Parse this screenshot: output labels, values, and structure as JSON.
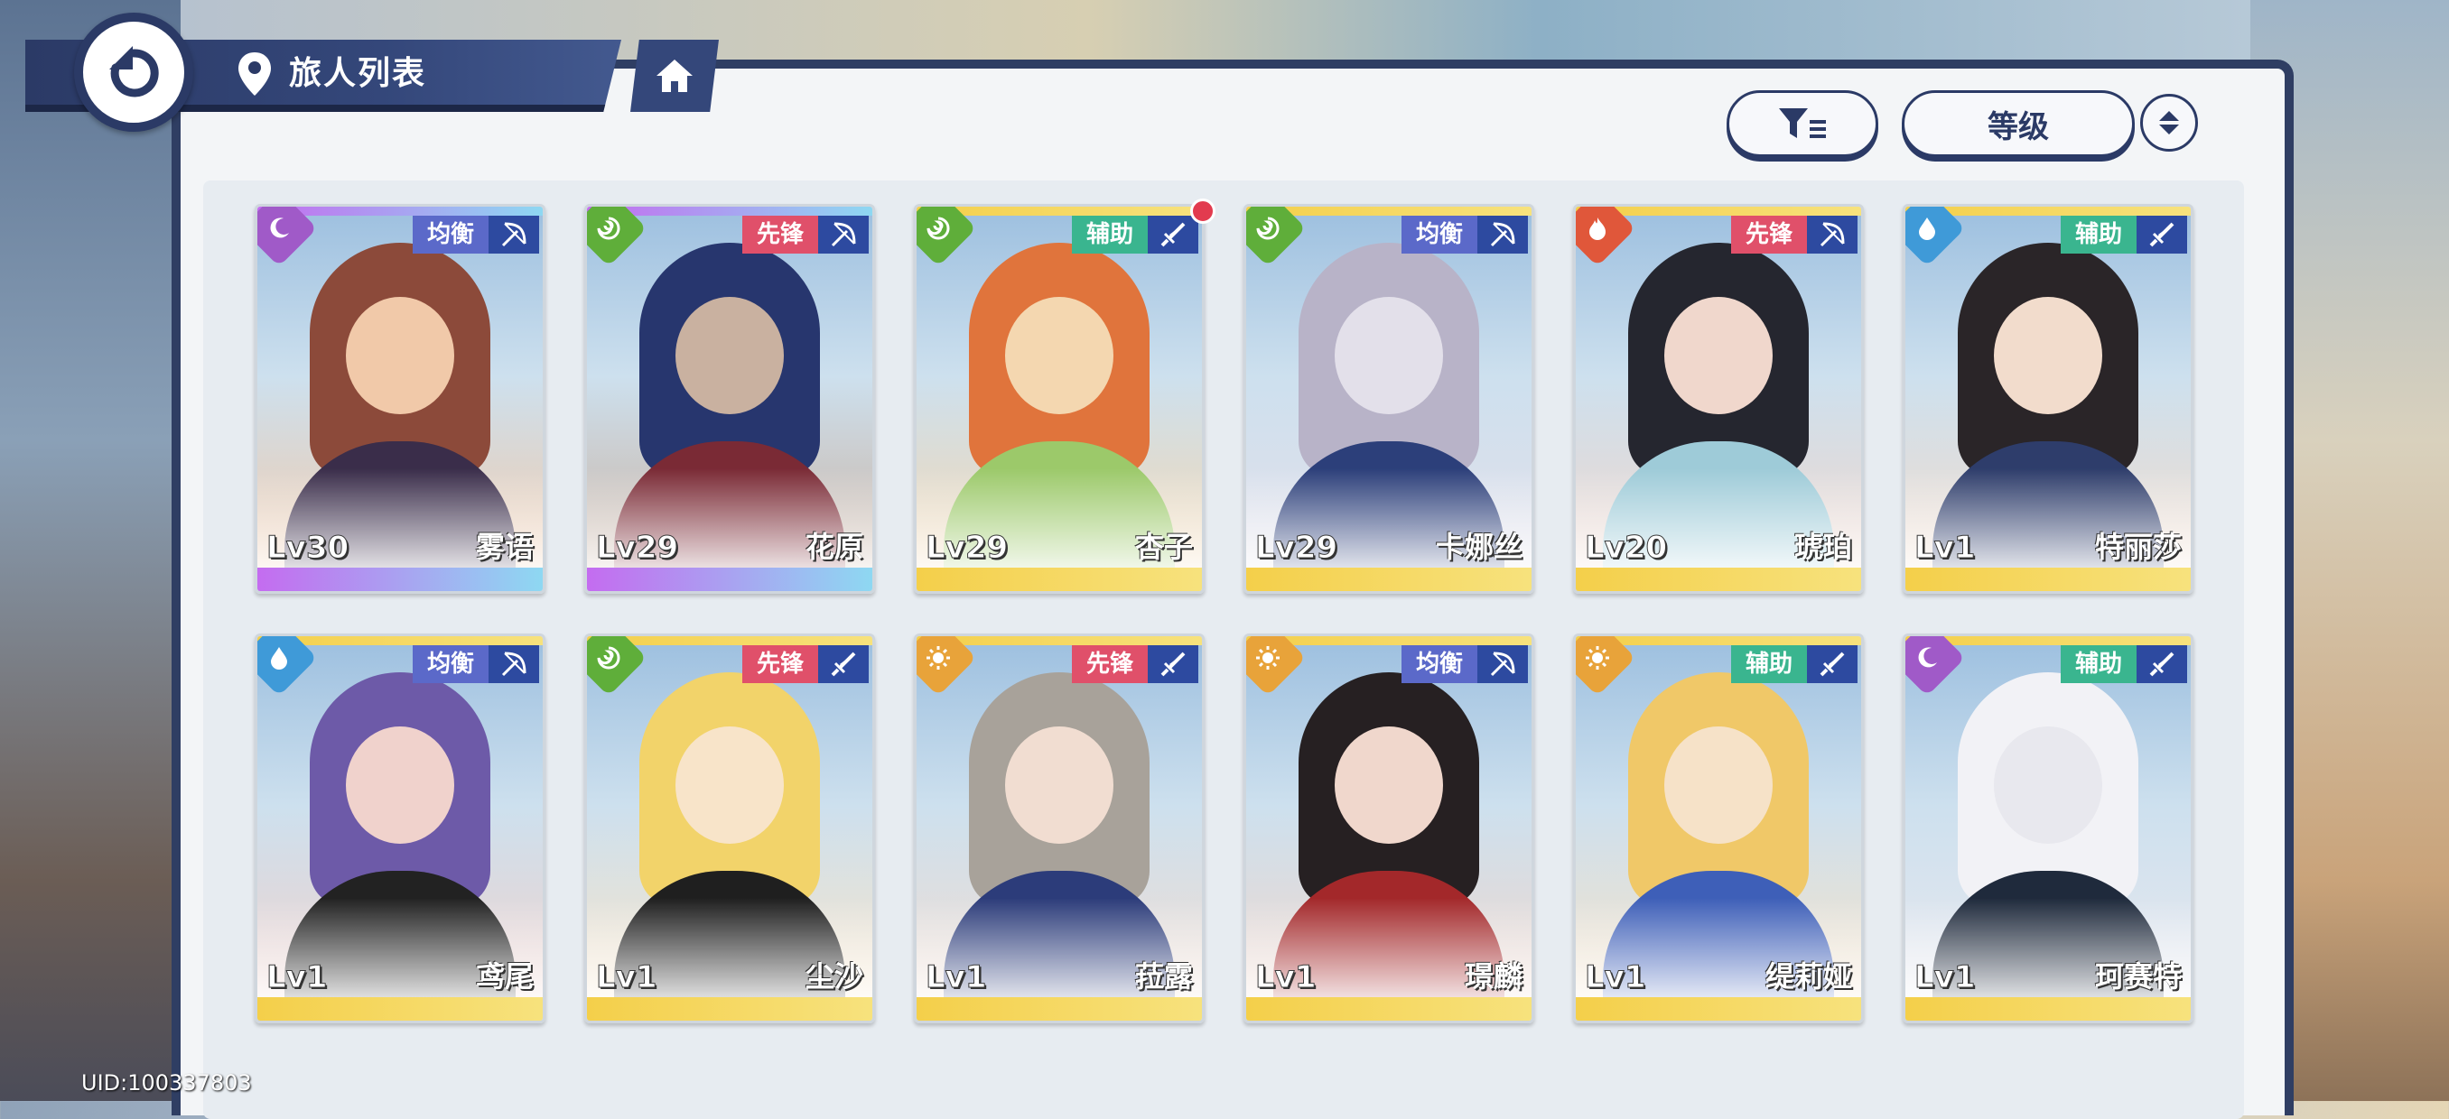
{
  "header": {
    "title": "旅人列表"
  },
  "toolbar": {
    "sort_label": "等级"
  },
  "footer": {
    "uid": "UID:100337803"
  },
  "colors": {
    "navy": "#2b3a66",
    "balance": "#5b69c9",
    "vanguard": "#e0506a",
    "support": "#3ab58f"
  },
  "characters": [
    {
      "name": "雾语",
      "level": "Lv30",
      "role": "均衡",
      "element": "moon",
      "weapon": "bow-icon",
      "rarity": "purple"
    },
    {
      "name": "花原",
      "level": "Lv29",
      "role": "先锋",
      "element": "wind",
      "weapon": "bow-icon",
      "rarity": "purple"
    },
    {
      "name": "杏子",
      "level": "Lv29",
      "role": "辅助",
      "element": "wind",
      "weapon": "sword-icon",
      "rarity": "gold"
    },
    {
      "name": "卡娜丝",
      "level": "Lv29",
      "role": "均衡",
      "element": "wind",
      "weapon": "bow-icon",
      "rarity": "gold"
    },
    {
      "name": "琥珀",
      "level": "Lv20",
      "role": "先锋",
      "element": "fire",
      "weapon": "bow-icon",
      "rarity": "gold"
    },
    {
      "name": "特丽莎",
      "level": "Lv1",
      "role": "辅助",
      "element": "water",
      "weapon": "sword-icon",
      "rarity": "gold"
    },
    {
      "name": "鸢尾",
      "level": "Lv1",
      "role": "均衡",
      "element": "water",
      "weapon": "bow-icon",
      "rarity": "gold"
    },
    {
      "name": "尘沙",
      "level": "Lv1",
      "role": "先锋",
      "element": "wind",
      "weapon": "sword-icon",
      "rarity": "gold"
    },
    {
      "name": "菈露",
      "level": "Lv1",
      "role": "先锋",
      "element": "sun",
      "weapon": "sword-icon",
      "rarity": "gold"
    },
    {
      "name": "璟麟",
      "level": "Lv1",
      "role": "均衡",
      "element": "sun",
      "weapon": "bow-icon",
      "rarity": "gold"
    },
    {
      "name": "缇莉娅",
      "level": "Lv1",
      "role": "辅助",
      "element": "sun",
      "weapon": "sword-icon",
      "rarity": "gold"
    },
    {
      "name": "珂赛特",
      "level": "Lv1",
      "role": "辅助",
      "element": "moon",
      "weapon": "sword-icon",
      "rarity": "gold"
    }
  ]
}
